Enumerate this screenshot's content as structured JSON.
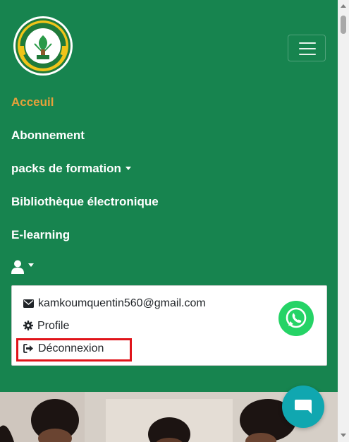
{
  "brand": {
    "logo_text_top": "EPREUVE EXPRESS",
    "logo_initials": "EE",
    "logo_text_bottom": "TRAVAIL SUCCES"
  },
  "nav": {
    "items": [
      {
        "label": "Acceuil",
        "active": true
      },
      {
        "label": "Abonnement"
      },
      {
        "label": "packs de formation",
        "dropdown": true
      },
      {
        "label": "Bibliothèque électronique"
      },
      {
        "label": "E-learning"
      }
    ]
  },
  "user_menu": {
    "email": "kamkoumquentin560@gmail.com",
    "profile_label": "Profile",
    "logout_label": "Déconnexion"
  },
  "icons": {
    "menu": "hamburger-icon",
    "user": "user-icon",
    "email": "envelope-icon",
    "profile": "gear-icon",
    "logout": "sign-out-icon",
    "whatsapp": "whatsapp-icon",
    "chat": "chat-bubble-icon"
  },
  "colors": {
    "navbar_bg": "#17844f",
    "active_link": "#e6a03a",
    "highlight_box": "#e0141a",
    "whatsapp": "#25d366",
    "chat_button": "#10a7b0"
  }
}
